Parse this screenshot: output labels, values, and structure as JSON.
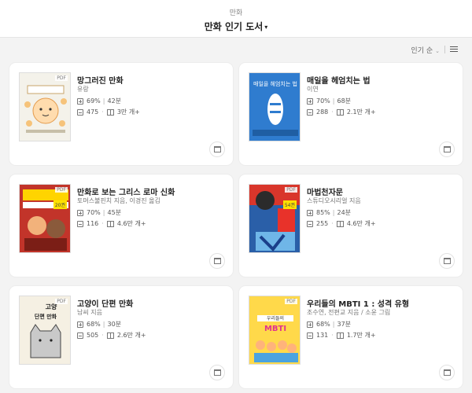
{
  "header": {
    "crumb": "만화",
    "title": "만화 인기 도서",
    "caret": "▾"
  },
  "sort": {
    "label": "인기 순",
    "chevron": "⌄"
  },
  "books": [
    {
      "title": "망그러진 만화",
      "author": "유랑",
      "read_percent": "69%",
      "read_time": "42분",
      "comments": "475",
      "shelves": "3만 개+",
      "pdf": "PDF",
      "cover_color": "#f4f2ea"
    },
    {
      "title": "매일을 헤엄치는 법",
      "author": "이연",
      "read_percent": "70%",
      "read_time": "68분",
      "comments": "288",
      "shelves": "2.1만 개+",
      "pdf": "",
      "cover_color": "#2f7ccf"
    },
    {
      "title": "만화로 보는 그리스 로마 신화",
      "author": "토머스불핀치 지음, 이경진 옮김",
      "read_percent": "70%",
      "read_time": "45분",
      "comments": "116",
      "shelves": "4.6만 개+",
      "pdf": "PDF",
      "badge": "20권",
      "cover_color": "#c2342a"
    },
    {
      "title": "마법천자문",
      "author": "스튜디오시리얼 지음",
      "read_percent": "85%",
      "read_time": "24분",
      "comments": "255",
      "shelves": "4.6만 개+",
      "pdf": "PDF",
      "badge": "54권",
      "cover_color": "#2a5fa8"
    },
    {
      "title": "고양이 단편 만화",
      "author": "남씨 지음",
      "read_percent": "68%",
      "read_time": "30분",
      "comments": "505",
      "shelves": "2.6만 개+",
      "pdf": "PDF",
      "cover_color": "#f5f0e3"
    },
    {
      "title": "우리들의 MBTI 1 : 성격 유형",
      "author": "조수연, 전편교 지음 / 소윤 그림",
      "read_percent": "68%",
      "read_time": "37분",
      "comments": "131",
      "shelves": "1.7만 개+",
      "pdf": "PDF",
      "cover_color": "#ffd94a"
    }
  ],
  "icons": {
    "read": "plus-square-icon",
    "comment": "comment-icon",
    "shelf": "book-icon",
    "add_to_shelf": "add-to-shelf-icon",
    "list_view": "list-view-icon"
  },
  "separators": {
    "bar": "|",
    "dot": "·"
  }
}
